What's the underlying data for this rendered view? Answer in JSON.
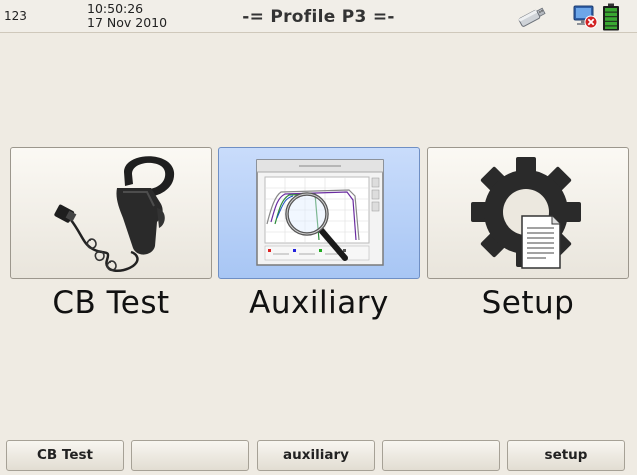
{
  "header": {
    "id_label": "123",
    "time": "10:50:26",
    "date": "17 Nov 2010",
    "title": "-= Profile P3 =-",
    "icons": [
      "usb-drive-icon",
      "network-disconnected-icon",
      "battery-icon"
    ]
  },
  "tiles": [
    {
      "label": "CB Test",
      "icon": "current-clamp-icon",
      "selected": false
    },
    {
      "label": "Auxiliary",
      "icon": "profile-chart-magnifier-icon",
      "selected": true
    },
    {
      "label": "Setup",
      "icon": "gear-document-icon",
      "selected": false
    }
  ],
  "softkeys": [
    {
      "label": "CB Test"
    },
    {
      "label": ""
    },
    {
      "label": "auxiliary"
    },
    {
      "label": ""
    },
    {
      "label": "setup"
    }
  ],
  "colors": {
    "background": "#efebe3",
    "selected_tile": "#b9d1f8",
    "battery_green": "#3aa832",
    "error_red": "#d22222"
  }
}
